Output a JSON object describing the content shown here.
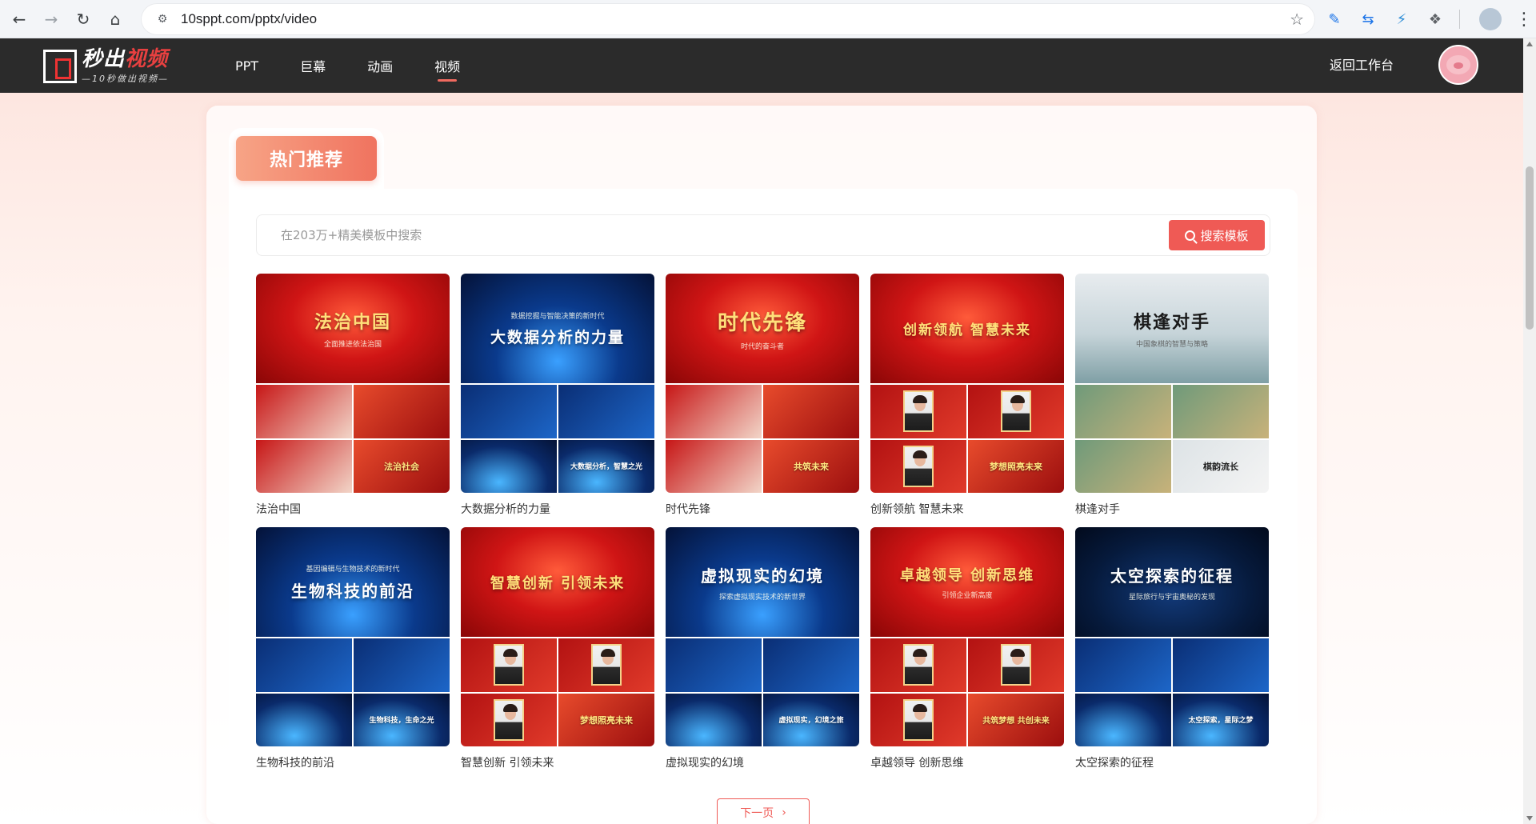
{
  "browser": {
    "url": "10sppt.com/pptx/video"
  },
  "site": {
    "logo_main_white": "秒出",
    "logo_main_red": "视频",
    "logo_tagline": "—10秒做出视频—",
    "nav": [
      "PPT",
      "巨幕",
      "动画",
      "视频"
    ],
    "active_nav": "视频",
    "back_link": "返回工作台"
  },
  "section": {
    "tab_label": "热门推荐"
  },
  "search": {
    "placeholder": "在203万+精美模板中搜索",
    "button_label": "搜索模板"
  },
  "templates": [
    {
      "caption": "法治中国",
      "cover_title": "法治中国",
      "cover_sub": "全面推进依法治国",
      "cell_text": "法治社会",
      "theme": "red"
    },
    {
      "caption": "大数据分析的力量",
      "cover_title": "大数据分析的力量",
      "cover_sub": "数据挖掘与智能决策的新时代",
      "cell_text": "大数据分析，智慧之光",
      "theme": "blue"
    },
    {
      "caption": "时代先锋",
      "cover_title": "时代先锋",
      "cover_sub": "时代的奋斗者",
      "cell_text": "共筑未来",
      "theme": "red"
    },
    {
      "caption": "创新领航 智慧未来",
      "cover_title": "创新领航  智慧未来",
      "cover_sub": "",
      "cell_text": "梦想照亮未来",
      "theme": "portrait"
    },
    {
      "caption": "棋逢对手",
      "cover_title": "棋逢对手",
      "cover_sub": "中国象棋的智慧与策略",
      "cell_text": "棋韵流长",
      "theme": "ink"
    },
    {
      "caption": "生物科技的前沿",
      "cover_title": "生物科技的前沿",
      "cover_sub": "基因编辑与生物技术的新时代",
      "cell_text": "生物科技，生命之光",
      "theme": "blue"
    },
    {
      "caption": "智慧创新 引领未来",
      "cover_title": "智慧创新 引领未来",
      "cover_sub": "",
      "cell_text": "梦想照亮未来",
      "theme": "portrait"
    },
    {
      "caption": "虚拟现实的幻境",
      "cover_title": "虚拟现实的幻境",
      "cover_sub": "探索虚拟现实技术的新世界",
      "cell_text": "虚拟现实，幻境之旅",
      "theme": "blue"
    },
    {
      "caption": "卓越领导 创新思维",
      "cover_title": "卓越领导 创新思维",
      "cover_sub": "引领企业新高度",
      "cell_text": "共筑梦想 共创未来",
      "theme": "portrait"
    },
    {
      "caption": "太空探索的征程",
      "cover_title": "太空探索的征程",
      "cover_sub": "星际旅行与宇宙奥秘的发现",
      "cell_text": "太空探索，星际之梦",
      "theme": "blue"
    }
  ],
  "pagination": {
    "next_label": "下一页"
  },
  "colors": {
    "accent": "#ef5a55",
    "header_bg": "#2b2b2b",
    "tab_gradient_start": "#f7a486",
    "tab_gradient_end": "#f0735f"
  }
}
